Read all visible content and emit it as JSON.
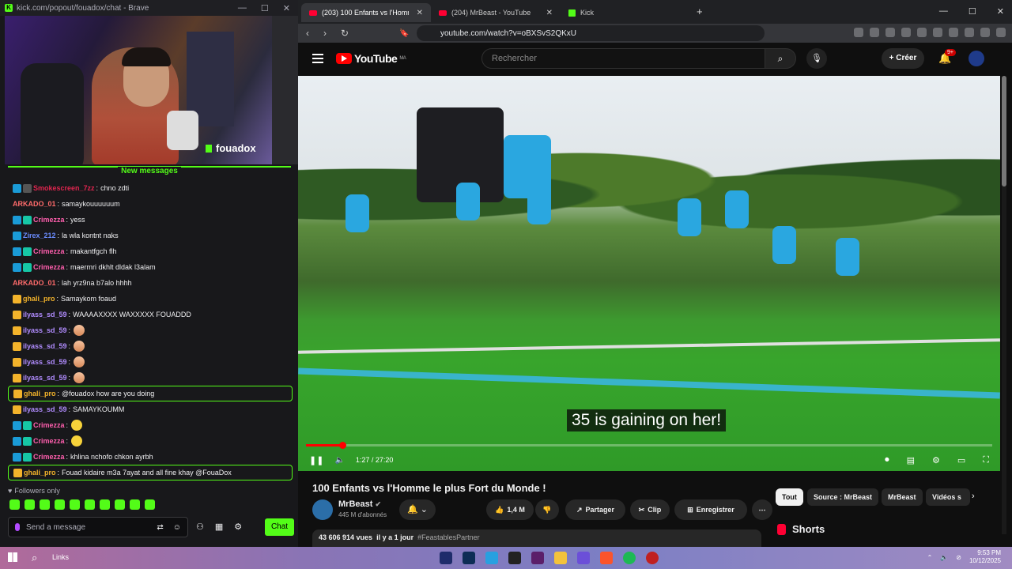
{
  "left_window": {
    "title": "kick.com/popout/fouadox/chat - Brave",
    "streamer": "fouadox",
    "new_messages_label": "New messages",
    "messages": [
      {
        "user": "Smokescreen_7zz",
        "text": "chno zdti",
        "badges": [
          "blue",
          "gray"
        ],
        "color": "#e0254f",
        "emoji": ""
      },
      {
        "user": "ARKADO_01",
        "text": "samaykouuuuuum",
        "badges": [],
        "color": "#ff6b6b",
        "emoji": ""
      },
      {
        "user": "Crimezza",
        "text": "yess",
        "badges": [
          "blue",
          "teal"
        ],
        "color": "#ff5fae",
        "emoji": ""
      },
      {
        "user": "Zirex_212",
        "text": "la wla kontnt naks",
        "badges": [
          "blue"
        ],
        "color": "#6a8cff",
        "emoji": ""
      },
      {
        "user": "Crimezza",
        "text": "makantfgch flh",
        "badges": [
          "blue",
          "teal"
        ],
        "color": "#ff5fae",
        "emoji": ""
      },
      {
        "user": "Crimezza",
        "text": "maermri dkhlt dldak l3alam",
        "badges": [
          "blue",
          "teal"
        ],
        "color": "#ff5fae",
        "emoji": ""
      },
      {
        "user": "ARKADO_01",
        "text": "lah yrz9na b7alo hhhh",
        "badges": [],
        "color": "#ff6b6b",
        "emoji": ""
      },
      {
        "user": "ghali_pro",
        "text": "Samaykom foaud",
        "badges": [
          "gold"
        ],
        "color": "#f3b32b",
        "emoji": ""
      },
      {
        "user": "ilyass_sd_59",
        "text": "WAAAAXXXX WAXXXXX FOUADDD",
        "badges": [
          "gold"
        ],
        "color": "#b18cff",
        "emoji": ""
      },
      {
        "user": "ilyass_sd_59",
        "text": "",
        "badges": [
          "gold"
        ],
        "color": "#b18cff",
        "emoji": "pinch"
      },
      {
        "user": "ilyass_sd_59",
        "text": "",
        "badges": [
          "gold"
        ],
        "color": "#b18cff",
        "emoji": "pinch"
      },
      {
        "user": "ilyass_sd_59",
        "text": "",
        "badges": [
          "gold"
        ],
        "color": "#b18cff",
        "emoji": "pinch"
      },
      {
        "user": "ilyass_sd_59",
        "text": "",
        "badges": [
          "gold"
        ],
        "color": "#b18cff",
        "emoji": "pinch"
      },
      {
        "user": "ghali_pro",
        "text": "@fouadox how are you doing",
        "badges": [
          "gold"
        ],
        "color": "#f3b32b",
        "emoji": "",
        "highlight": true
      },
      {
        "user": "ilyass_sd_59",
        "text": "SAMAYKOUMM",
        "badges": [
          "gold"
        ],
        "color": "#b18cff",
        "emoji": ""
      },
      {
        "user": "Crimezza",
        "text": "",
        "badges": [
          "blue",
          "teal"
        ],
        "color": "#ff5fae",
        "emoji": "smile"
      },
      {
        "user": "Crimezza",
        "text": "",
        "badges": [
          "blue",
          "teal"
        ],
        "color": "#ff5fae",
        "emoji": "smile"
      },
      {
        "user": "Crimezza",
        "text": "khlina nchofo chkon ayrbh",
        "badges": [
          "blue",
          "teal"
        ],
        "color": "#ff5fae",
        "emoji": ""
      },
      {
        "user": "ghali_pro",
        "text": "Fouad kidaire m3a 7ayat and all fine khay @FouaDox",
        "badges": [
          "gold"
        ],
        "color": "#f3b32b",
        "emoji": "",
        "highlight": true
      }
    ],
    "followers_only": "Followers only",
    "send_placeholder": "Send a message",
    "chat_button": "Chat"
  },
  "browser": {
    "tabs": [
      {
        "label": "(203) 100 Enfants vs l'Homme",
        "active": true
      },
      {
        "label": "(204) MrBeast - YouTube",
        "active": false
      },
      {
        "label": "Kick",
        "active": false
      }
    ],
    "url": "youtube.com/watch?v=oBXSvS2QKxU"
  },
  "youtube": {
    "logo": "YouTube",
    "region": "MA",
    "search_placeholder": "Rechercher",
    "create_label": "Créer",
    "notif_count": "9+",
    "video": {
      "subtitle": "35 is gaining on her!",
      "time": "1:27 / 27:20",
      "progress": 0.053,
      "title": "100 Enfants vs l'Homme le plus Fort du Monde !"
    },
    "channel": {
      "name": "MrBeast",
      "subs": "445 M d'abonnés"
    },
    "actions": {
      "likes": "1,4 M",
      "share": "Partager",
      "clip": "Clip",
      "save": "Enregistrer"
    },
    "description": {
      "views": "43 606 914 vues",
      "date": "il y a 1 jour",
      "tag": "#FeastablesPartner"
    },
    "chips": [
      "Tout",
      "Source : MrBeast",
      "MrBeast",
      "Vidéos s"
    ],
    "shorts_label": "Shorts"
  },
  "taskbar": {
    "search_label": "Links",
    "time": "9:53 PM",
    "date": "10/12/2025"
  }
}
